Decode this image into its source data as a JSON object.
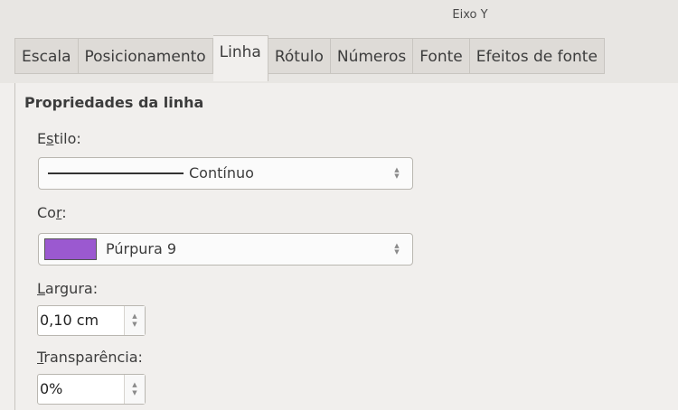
{
  "window": {
    "title": "Eixo Y"
  },
  "tabs": [
    {
      "label": "Escala"
    },
    {
      "label": "Posicionamento"
    },
    {
      "label": "Linha",
      "active": true
    },
    {
      "label": "Rótulo"
    },
    {
      "label": "Números"
    },
    {
      "label": "Fonte"
    },
    {
      "label": "Efeitos de fonte"
    }
  ],
  "section": {
    "title": "Propriedades da linha"
  },
  "style": {
    "label_pre": "E",
    "label_mnemonic": "s",
    "label_post": "tilo:",
    "value": "Contínuo"
  },
  "color": {
    "label_pre": "Co",
    "label_mnemonic": "r",
    "label_post": ":",
    "value": "Púrpura 9",
    "swatch": "#9b59d0"
  },
  "width": {
    "label_pre": "",
    "label_mnemonic": "L",
    "label_post": "argura:",
    "value": "0,10 cm"
  },
  "transparency": {
    "label_pre": "",
    "label_mnemonic": "T",
    "label_post": "ransparência:",
    "value": "0%"
  }
}
